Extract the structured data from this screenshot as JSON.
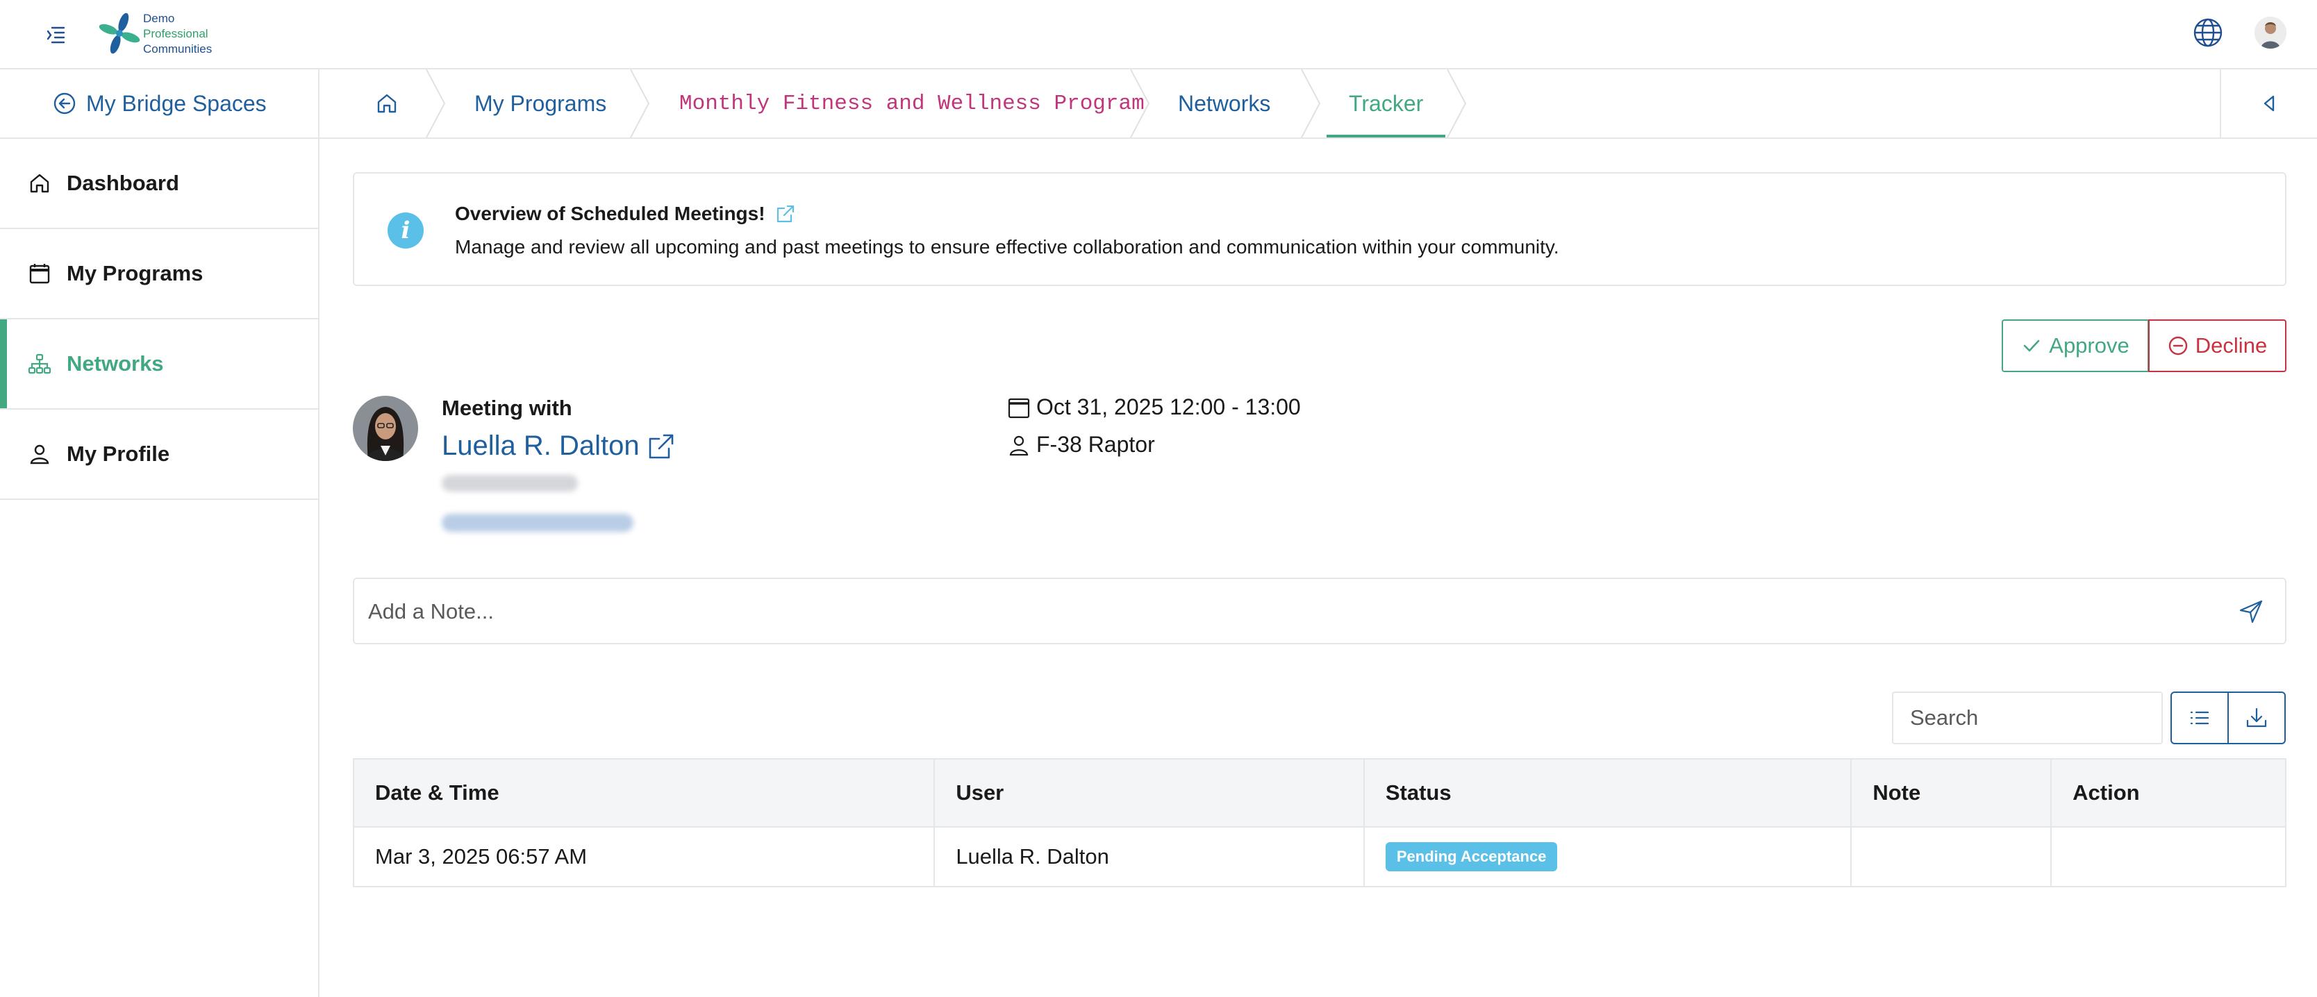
{
  "brand": {
    "line1": "Demo",
    "line2": "Professional",
    "line3": "Communities"
  },
  "sidebar": {
    "back_label": "My Bridge Spaces",
    "items": [
      {
        "label": "Dashboard",
        "icon": "home-icon"
      },
      {
        "label": "My Programs",
        "icon": "calendar-icon"
      },
      {
        "label": "Networks",
        "icon": "network-icon",
        "active": true
      },
      {
        "label": "My Profile",
        "icon": "user-icon"
      }
    ]
  },
  "breadcrumb": {
    "home_icon": "home-icon",
    "items": [
      "My Programs",
      "Monthly Fitness and Wellness Program",
      "Networks",
      "Tracker"
    ]
  },
  "info": {
    "title": "Overview of Scheduled Meetings!",
    "description": "Manage and review all upcoming and past meetings to ensure effective collaboration and communication within your community."
  },
  "actions": {
    "approve": "Approve",
    "decline": "Decline"
  },
  "meeting": {
    "label": "Meeting with",
    "name": "Luella R. Dalton",
    "datetime": "Oct 31, 2025 12:00 - 13:00",
    "location": "F-38 Raptor"
  },
  "note": {
    "placeholder": "Add a Note..."
  },
  "search": {
    "placeholder": "Search"
  },
  "table": {
    "columns": [
      "Date & Time",
      "User",
      "Status",
      "Note",
      "Action"
    ],
    "rows": [
      {
        "datetime": "Mar 3, 2025 06:57 AM",
        "user": "Luella R. Dalton",
        "status": "Pending Acceptance",
        "note": "",
        "action": ""
      }
    ]
  },
  "colors": {
    "primary": "#1f5f9e",
    "accent": "#42a882",
    "danger": "#c8333f",
    "info": "#5bc0e8",
    "crumb_program": "#c2357a"
  }
}
